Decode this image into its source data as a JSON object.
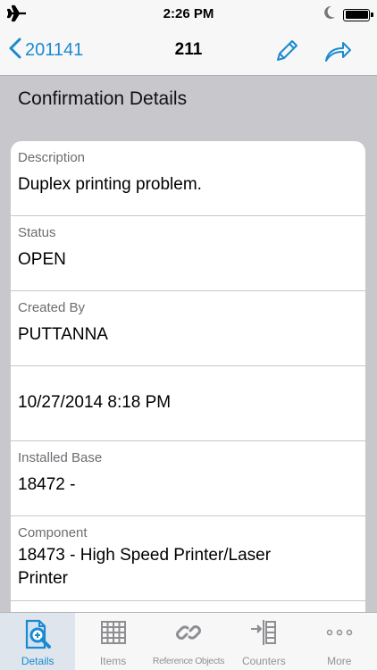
{
  "status_bar": {
    "time": "2:26 PM",
    "icons": [
      "airplane-icon",
      "moon-icon",
      "battery-icon"
    ]
  },
  "nav": {
    "back_label": "201141",
    "title": "211",
    "actions": [
      "edit-icon",
      "share-icon"
    ]
  },
  "section": {
    "title": "Confirmation Details"
  },
  "fields": {
    "description": {
      "label": "Description",
      "value": "Duplex printing problem."
    },
    "status": {
      "label": "Status",
      "value": "OPEN"
    },
    "created_by": {
      "label": "Created By",
      "value": "PUTTANNA"
    },
    "created_on": {
      "value": "10/27/2014 8:18 PM"
    },
    "installed_base": {
      "label": "Installed Base",
      "value": "18472 -"
    },
    "component": {
      "label": "Component",
      "value_line1": "18473 - High Speed Printer/Laser",
      "value_line2": "Printer"
    }
  },
  "tabs": {
    "details": "Details",
    "items": "Items",
    "reference_objects": "Reference Objects",
    "counters": "Counters",
    "more": "More",
    "selected": "Details"
  },
  "colors": {
    "accent": "#1a8ad0",
    "background": "#c8c8cc",
    "tab_inactive": "#929292"
  }
}
